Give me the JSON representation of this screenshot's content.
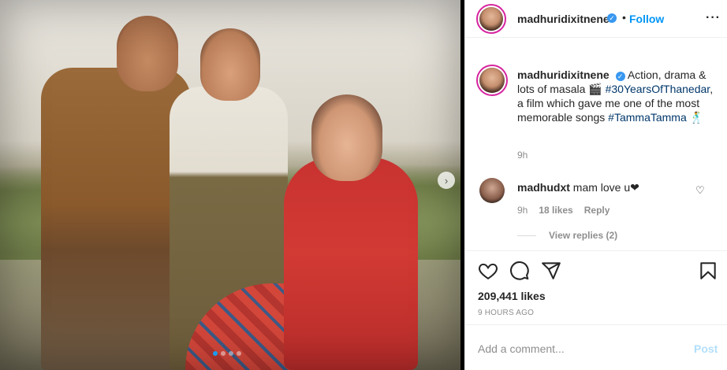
{
  "media": {
    "slide_count": 4,
    "active_slide": 1,
    "next_icon": "chevron-right-icon"
  },
  "header": {
    "username": "madhuridixitnene",
    "verified_icon": "verified-badge-icon",
    "bullet": "•",
    "follow_label": "Follow",
    "more_label": "···"
  },
  "caption": {
    "username": "madhuridixitnene",
    "text_1": "Action, drama & lots of masala 🎬",
    "hashtag_1": "#30YearsOfThanedar",
    "text_2": ", a film which gave me one of the most memorable songs ",
    "hashtag_2": "#TammaTamma",
    "text_3": " 🕺",
    "time": "9h"
  },
  "comments": [
    {
      "username": "madhudxt",
      "text": "mam love u❤",
      "time": "9h",
      "likes": "18 likes",
      "reply_label": "Reply",
      "view_replies": "View replies (2)"
    }
  ],
  "actions": {
    "like_icon": "heart-icon",
    "comment_icon": "comment-icon",
    "share_icon": "share-icon",
    "save_icon": "bookmark-icon"
  },
  "stats": {
    "likes": "209,441 likes",
    "time_ago": "9 HOURS AGO"
  },
  "add_comment": {
    "placeholder": "Add a comment...",
    "post_label": "Post"
  },
  "colors": {
    "link_blue": "#0095f6",
    "hashtag": "#00376b",
    "muted": "#8e8e8e",
    "story_ring": "#d6249f"
  }
}
